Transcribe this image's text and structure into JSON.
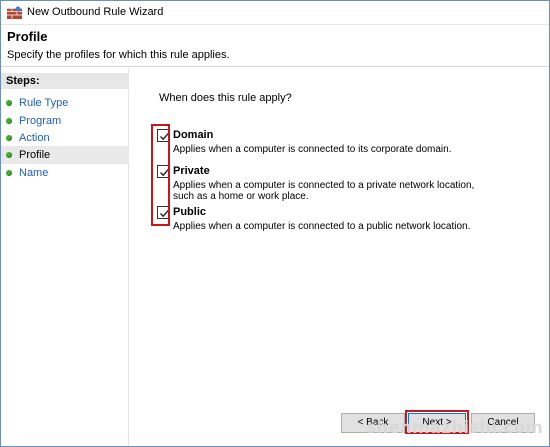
{
  "window": {
    "title": "New Outbound Rule Wizard"
  },
  "header": {
    "title": "Profile",
    "subtitle": "Specify the profiles for which this rule applies."
  },
  "steps": {
    "heading": "Steps:",
    "items": [
      {
        "label": "Rule Type",
        "state": "link"
      },
      {
        "label": "Program",
        "state": "link"
      },
      {
        "label": "Action",
        "state": "link"
      },
      {
        "label": "Profile",
        "state": "active"
      },
      {
        "label": "Name",
        "state": "link"
      }
    ]
  },
  "main": {
    "question": "When does this rule apply?",
    "options": [
      {
        "label": "Domain",
        "checked": true,
        "description": "Applies when a computer is connected to its corporate domain."
      },
      {
        "label": "Private",
        "checked": true,
        "description": "Applies when a computer is connected to a private network location, such as a home or work place."
      },
      {
        "label": "Public",
        "checked": true,
        "description": "Applies when a computer is connected to a public network location."
      }
    ]
  },
  "buttons": {
    "back": "< Back",
    "next": "Next >",
    "cancel": "Cancel"
  },
  "watermark": "shenmazhishi.com",
  "colors": {
    "highlight_box": "#c8161d",
    "step_dot": "#3fae2a",
    "link": "#1c5fb6"
  }
}
